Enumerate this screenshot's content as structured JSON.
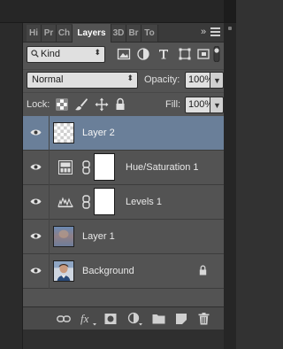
{
  "tabs": [
    {
      "label": "Hi",
      "active": false
    },
    {
      "label": "Pr",
      "active": false
    },
    {
      "label": "Ch",
      "active": false
    },
    {
      "label": "Layers",
      "active": true
    },
    {
      "label": "3D",
      "active": false
    },
    {
      "label": "Br",
      "active": false
    },
    {
      "label": "To",
      "active": false
    }
  ],
  "tab_overflow": "»",
  "filter": {
    "kind_label": "Kind",
    "icons": [
      "image-filter-icon",
      "adjustment-filter-icon",
      "type-filter-icon",
      "shape-filter-icon",
      "smart-object-filter-icon",
      "filter-toggle"
    ]
  },
  "blend": {
    "mode": "Normal",
    "opacity_label": "Opacity:",
    "opacity_value": "100%"
  },
  "lock": {
    "label": "Lock:",
    "fill_label": "Fill:",
    "fill_value": "100%"
  },
  "layers": [
    {
      "name": "Layer 2",
      "type": "transparent",
      "selected": true
    },
    {
      "name": "Hue/Saturation 1",
      "type": "hue-saturation-adjustment",
      "selected": false
    },
    {
      "name": "Levels 1",
      "type": "levels-adjustment",
      "selected": false
    },
    {
      "name": "Layer 1",
      "type": "pixel",
      "selected": false
    },
    {
      "name": "Background",
      "type": "background-locked",
      "selected": false
    }
  ],
  "bottom_icons": [
    "link-layers-icon",
    "fx-icon",
    "add-mask-icon",
    "new-adjustment-icon",
    "new-group-icon",
    "new-layer-icon",
    "delete-layer-icon"
  ],
  "colors": {
    "panel_bg": "#535353",
    "selected_row": "#6a7f99",
    "field_bg": "#e0e0e0"
  }
}
